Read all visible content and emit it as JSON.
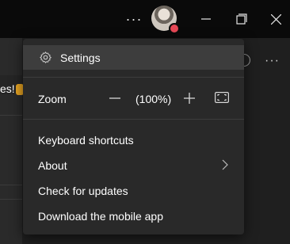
{
  "titlebar": {
    "more_label": "···",
    "icons": [
      "more-icon",
      "avatar",
      "minimize-icon",
      "maximize-icon",
      "close-icon"
    ],
    "presence_color": "#e74856"
  },
  "background": {
    "left_text": "es!"
  },
  "menu": {
    "settings_label": "Settings",
    "zoom_label": "Zoom",
    "zoom_value": "(100%)",
    "items": [
      {
        "label": "Keyboard shortcuts"
      },
      {
        "label": "About"
      },
      {
        "label": "Check for updates"
      },
      {
        "label": "Download the mobile app"
      }
    ]
  }
}
